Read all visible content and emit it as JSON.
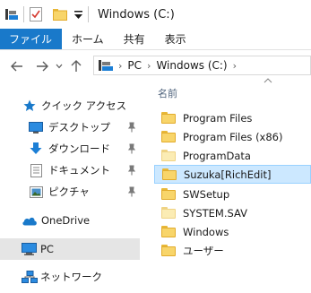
{
  "window": {
    "title": "Windows (C:)"
  },
  "ribbon": {
    "tabs": [
      "ファイル",
      "ホーム",
      "共有",
      "表示"
    ]
  },
  "address": {
    "crumbs": [
      "PC",
      "Windows (C:)"
    ]
  },
  "navpane": {
    "items": [
      {
        "label": "クイック アクセス",
        "icon": "star-icon"
      },
      {
        "label": "デスクトップ",
        "icon": "desktop-icon",
        "pinned": true
      },
      {
        "label": "ダウンロード",
        "icon": "download-icon",
        "pinned": true
      },
      {
        "label": "ドキュメント",
        "icon": "documents-icon",
        "pinned": true
      },
      {
        "label": "ピクチャ",
        "icon": "pictures-icon",
        "pinned": true
      },
      {
        "label": "OneDrive",
        "icon": "cloud-icon"
      },
      {
        "label": "PC",
        "icon": "pc-icon",
        "selected": true
      },
      {
        "label": "ネットワーク",
        "icon": "network-icon"
      }
    ]
  },
  "content": {
    "column_header": "名前",
    "files": [
      {
        "name": "Program Files",
        "type": "folder"
      },
      {
        "name": "Program Files (x86)",
        "type": "folder"
      },
      {
        "name": "ProgramData",
        "type": "folder-hidden"
      },
      {
        "name": "Suzuka[RichEdit]",
        "type": "folder",
        "selected": true
      },
      {
        "name": "SWSetup",
        "type": "folder"
      },
      {
        "name": "SYSTEM.SAV",
        "type": "folder-hidden"
      },
      {
        "name": "Windows",
        "type": "folder"
      },
      {
        "name": "ユーザー",
        "type": "folder"
      }
    ]
  },
  "colors": {
    "accent": "#1979ca",
    "selection": "#cce8ff",
    "nav_selected": "#e5e5e5"
  }
}
